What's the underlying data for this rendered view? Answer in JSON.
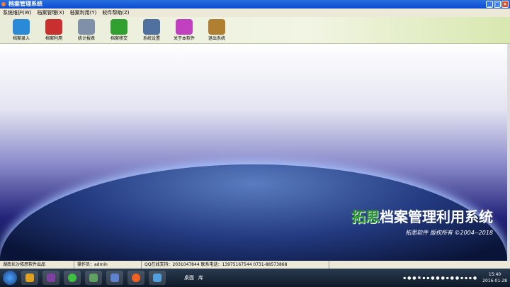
{
  "window": {
    "title": "档案管理系统"
  },
  "menu": [
    "系统维护(W)",
    "档案管理(X)",
    "档案利用(Y)",
    "软件帮助(Z)"
  ],
  "toolbar": [
    {
      "label": "档案录入",
      "icon": "user-add-icon",
      "color": "#2a8ad8"
    },
    {
      "label": "档案利用",
      "icon": "calendar-clock-icon",
      "color": "#c83030"
    },
    {
      "label": "统计报表",
      "icon": "report-icon",
      "color": "#8090a8"
    },
    {
      "label": "档案移交",
      "icon": "users-icon",
      "color": "#30a030"
    },
    {
      "label": "系统设置",
      "icon": "settings-monitor-icon",
      "color": "#5070a0"
    },
    {
      "label": "关于本软件",
      "icon": "help-icon",
      "color": "#c040c0"
    },
    {
      "label": "退出系统",
      "icon": "exit-signpost-icon",
      "color": "#b08030"
    }
  ],
  "brand": {
    "name_a": "拓思",
    "name_b": "档案管理利用系统",
    "copyright": "拓思软件 版权所有 ©2004--2018"
  },
  "status": {
    "company": "湖南长沙拓思软件出品",
    "operator": "操作员：admin",
    "support": "QQ在线支持：2031047844  联系电话：13975167544  0731-88573868"
  },
  "taskbar": {
    "desktop": "桌面",
    "library": "库",
    "time": "15:40",
    "date": "2016-01-28"
  }
}
